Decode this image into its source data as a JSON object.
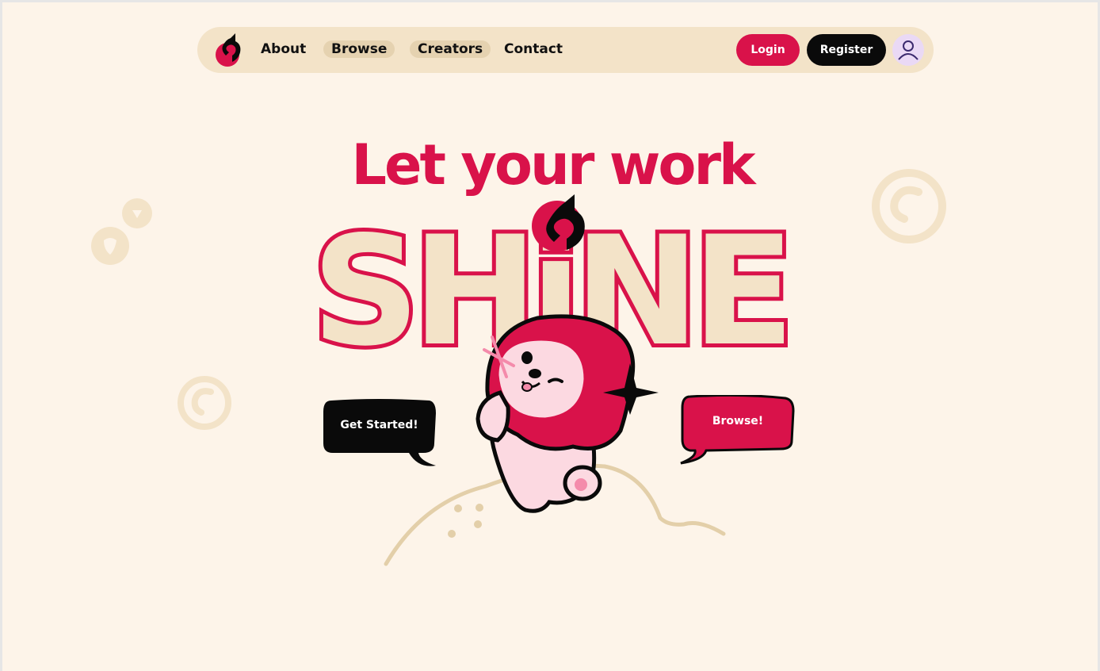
{
  "nav": {
    "links": [
      "About",
      "Browse",
      "Creators",
      "Contact"
    ],
    "login_label": "Login",
    "register_label": "Register"
  },
  "hero": {
    "headline": "Let your work",
    "shine_word": "SHiNE",
    "get_started_label": "Get Started!",
    "browse_label": "Browse!"
  },
  "colors": {
    "background": "#fdf4e9",
    "navbar": "#f3e3c8",
    "accent": "#d9124a",
    "dark": "#0a0a0a",
    "cream": "#f3e3c8"
  },
  "icons": {
    "logo": "creator-logo-icon",
    "user": "user-avatar-icon",
    "copyright": "copyright-circle-icon"
  }
}
